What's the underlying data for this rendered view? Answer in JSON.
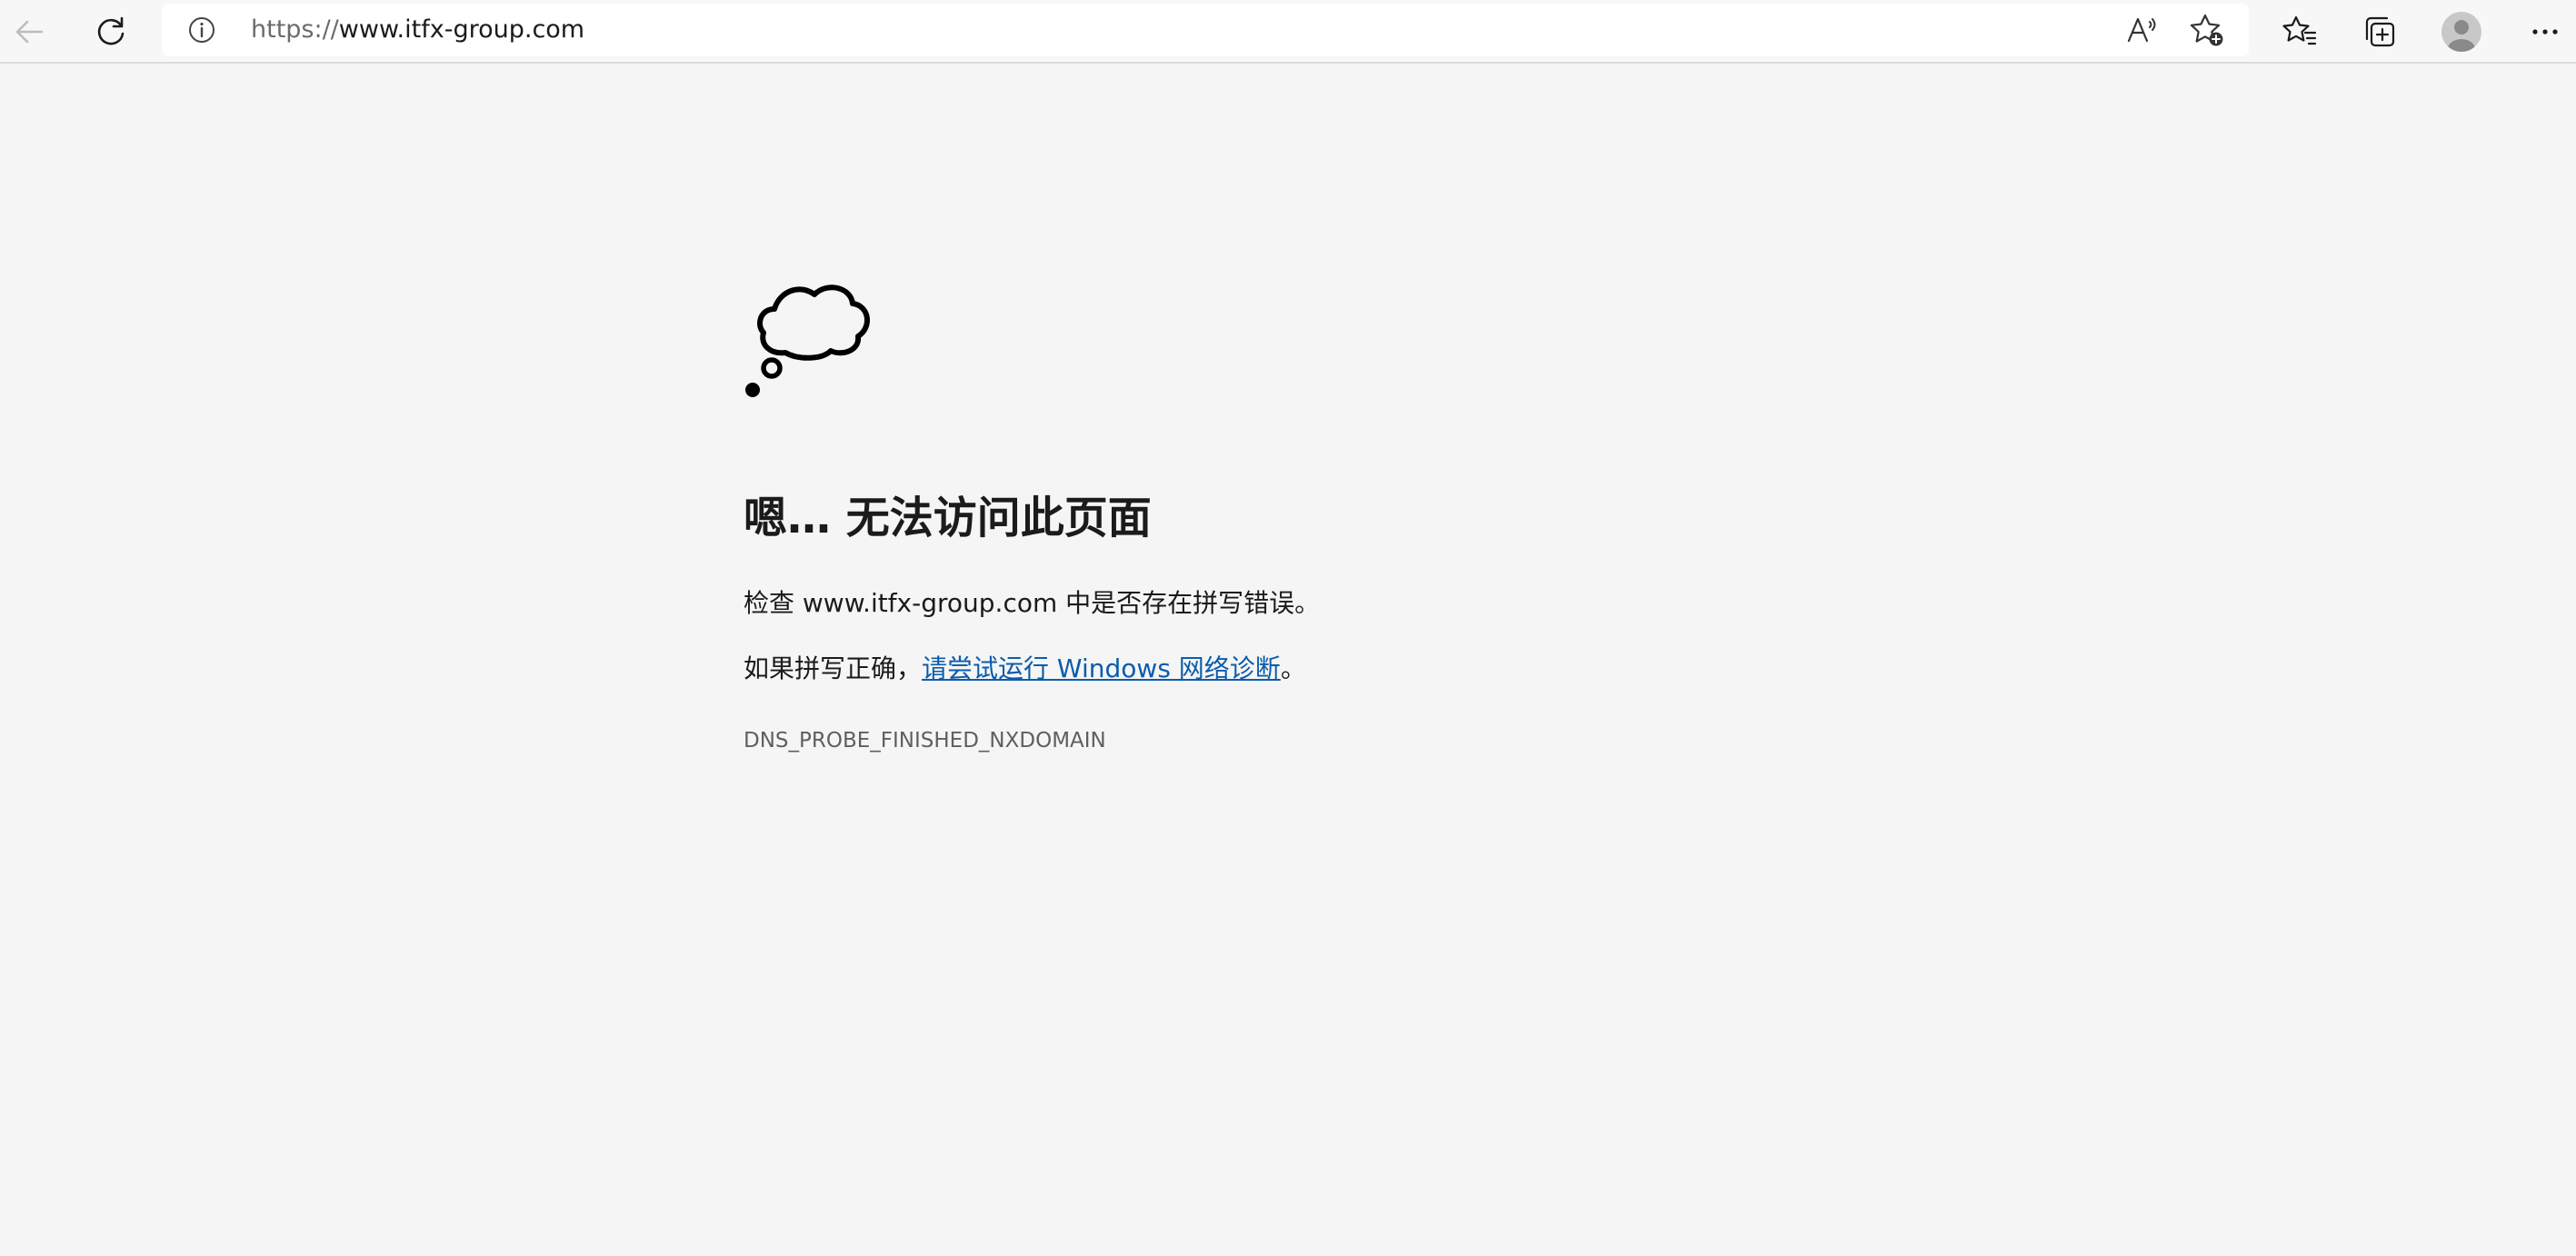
{
  "browser": {
    "address_bar": {
      "protocol": "https://",
      "host": "www.itfx-group.com"
    },
    "icons": {
      "back": "back-arrow-icon",
      "refresh": "refresh-icon",
      "site_info": "info-icon",
      "read_aloud": "read-aloud-icon",
      "add_favorite": "add-favorite-icon",
      "favorites": "favorites-icon",
      "collections": "collections-icon",
      "profile": "profile-avatar-icon",
      "menu": "more-menu-icon"
    }
  },
  "error_page": {
    "icon": "thought-cloud-icon",
    "heading": "嗯… 无法访问此页面",
    "check_text_before": "检查 ",
    "check_domain": "www.itfx-group.com",
    "check_text_after": " 中是否存在拼写错误。",
    "spelling_text": "如果拼写正确，",
    "diagnostics_link": "请尝试运行 Windows 网络诊断",
    "spelling_text_end": "。",
    "error_code": "DNS_PROBE_FINISHED_NXDOMAIN"
  },
  "colors": {
    "link": "#0b5cad",
    "page_background": "#f5f5f5",
    "toolbar_background": "#f7f7f7"
  }
}
